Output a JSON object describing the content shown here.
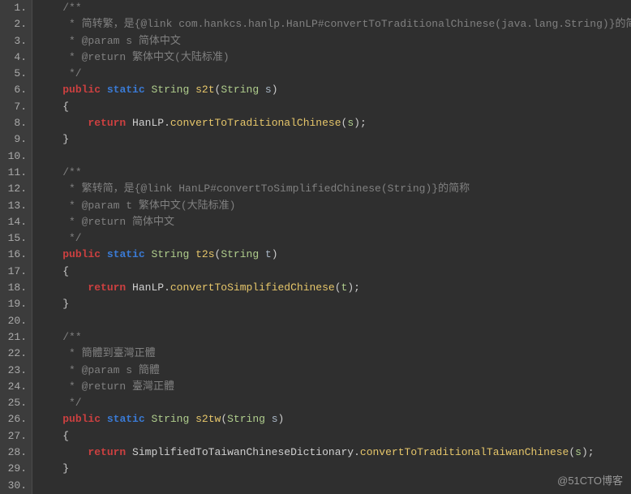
{
  "watermark": "@51CTO博客",
  "lines": [
    {
      "num": "1.",
      "tokens": [
        [
          "    ",
          ""
        ],
        [
          "/**",
          "c-comment"
        ]
      ]
    },
    {
      "num": "2.",
      "tokens": [
        [
          "     * 简转繁，是{@link com.hankcs.hanlp.HanLP#convertToTraditionalChinese(java.lang.String)}的简称",
          "c-comment"
        ]
      ]
    },
    {
      "num": "3.",
      "tokens": [
        [
          "     * @param s 简体中文",
          "c-comment"
        ]
      ]
    },
    {
      "num": "4.",
      "tokens": [
        [
          "     * @return 繁体中文(大陆标准)",
          "c-comment"
        ]
      ]
    },
    {
      "num": "5.",
      "tokens": [
        [
          "     */",
          "c-comment"
        ]
      ]
    },
    {
      "num": "6.",
      "tokens": [
        [
          "    ",
          ""
        ],
        [
          "public",
          "c-keyword"
        ],
        [
          " ",
          ""
        ],
        [
          "static",
          "c-keyword2"
        ],
        [
          " ",
          ""
        ],
        [
          "String",
          "c-type"
        ],
        [
          " ",
          ""
        ],
        [
          "s2t",
          "c-fname"
        ],
        [
          "(",
          "c-punct"
        ],
        [
          "String",
          "c-type"
        ],
        [
          " s",
          ""
        ],
        [
          ")",
          "c-punct"
        ]
      ]
    },
    {
      "num": "7.",
      "tokens": [
        [
          "    ",
          ""
        ],
        [
          "{",
          "c-punct"
        ]
      ]
    },
    {
      "num": "8.",
      "tokens": [
        [
          "        ",
          ""
        ],
        [
          "return",
          "c-keyword"
        ],
        [
          " ",
          ""
        ],
        [
          "HanLP",
          "c-ident"
        ],
        [
          ".",
          "c-punct"
        ],
        [
          "convertToTraditionalChinese",
          "c-method"
        ],
        [
          "(",
          "c-punct"
        ],
        [
          "s",
          "c-var"
        ],
        [
          ");",
          "c-punct"
        ]
      ]
    },
    {
      "num": "9.",
      "tokens": [
        [
          "    ",
          ""
        ],
        [
          "}",
          "c-punct"
        ]
      ]
    },
    {
      "num": "10.",
      "tokens": [
        [
          " ",
          ""
        ]
      ]
    },
    {
      "num": "11.",
      "tokens": [
        [
          "    ",
          ""
        ],
        [
          "/**",
          "c-comment"
        ]
      ]
    },
    {
      "num": "12.",
      "tokens": [
        [
          "     * 繁转简，是{@link HanLP#convertToSimplifiedChinese(String)}的简称",
          "c-comment"
        ]
      ]
    },
    {
      "num": "13.",
      "tokens": [
        [
          "     * @param t 繁体中文(大陆标准)",
          "c-comment"
        ]
      ]
    },
    {
      "num": "14.",
      "tokens": [
        [
          "     * @return 简体中文",
          "c-comment"
        ]
      ]
    },
    {
      "num": "15.",
      "tokens": [
        [
          "     */",
          "c-comment"
        ]
      ]
    },
    {
      "num": "16.",
      "tokens": [
        [
          "    ",
          ""
        ],
        [
          "public",
          "c-keyword"
        ],
        [
          " ",
          ""
        ],
        [
          "static",
          "c-keyword2"
        ],
        [
          " ",
          ""
        ],
        [
          "String",
          "c-type"
        ],
        [
          " ",
          ""
        ],
        [
          "t2s",
          "c-fname"
        ],
        [
          "(",
          "c-punct"
        ],
        [
          "String",
          "c-type"
        ],
        [
          " t",
          ""
        ],
        [
          ")",
          "c-punct"
        ]
      ]
    },
    {
      "num": "17.",
      "tokens": [
        [
          "    ",
          ""
        ],
        [
          "{",
          "c-punct"
        ]
      ]
    },
    {
      "num": "18.",
      "tokens": [
        [
          "        ",
          ""
        ],
        [
          "return",
          "c-keyword"
        ],
        [
          " ",
          ""
        ],
        [
          "HanLP",
          "c-ident"
        ],
        [
          ".",
          "c-punct"
        ],
        [
          "convertToSimplifiedChinese",
          "c-method"
        ],
        [
          "(",
          "c-punct"
        ],
        [
          "t",
          "c-var"
        ],
        [
          ");",
          "c-punct"
        ]
      ]
    },
    {
      "num": "19.",
      "tokens": [
        [
          "    ",
          ""
        ],
        [
          "}",
          "c-punct"
        ]
      ]
    },
    {
      "num": "20.",
      "tokens": [
        [
          " ",
          ""
        ]
      ]
    },
    {
      "num": "21.",
      "tokens": [
        [
          "    ",
          ""
        ],
        [
          "/**",
          "c-comment"
        ]
      ]
    },
    {
      "num": "22.",
      "tokens": [
        [
          "     * 簡體到臺灣正體",
          "c-comment"
        ]
      ]
    },
    {
      "num": "23.",
      "tokens": [
        [
          "     * @param s 簡體",
          "c-comment"
        ]
      ]
    },
    {
      "num": "24.",
      "tokens": [
        [
          "     * @return 臺灣正體",
          "c-comment"
        ]
      ]
    },
    {
      "num": "25.",
      "tokens": [
        [
          "     */",
          "c-comment"
        ]
      ]
    },
    {
      "num": "26.",
      "tokens": [
        [
          "    ",
          ""
        ],
        [
          "public",
          "c-keyword"
        ],
        [
          " ",
          ""
        ],
        [
          "static",
          "c-keyword2"
        ],
        [
          " ",
          ""
        ],
        [
          "String",
          "c-type"
        ],
        [
          " ",
          ""
        ],
        [
          "s2tw",
          "c-fname"
        ],
        [
          "(",
          "c-punct"
        ],
        [
          "String",
          "c-type"
        ],
        [
          " s",
          ""
        ],
        [
          ")",
          "c-punct"
        ]
      ]
    },
    {
      "num": "27.",
      "tokens": [
        [
          "    ",
          ""
        ],
        [
          "{",
          "c-punct"
        ]
      ]
    },
    {
      "num": "28.",
      "tokens": [
        [
          "        ",
          ""
        ],
        [
          "return",
          "c-keyword"
        ],
        [
          " ",
          ""
        ],
        [
          "SimplifiedToTaiwanChineseDictionary",
          "c-ident"
        ],
        [
          ".",
          "c-punct"
        ],
        [
          "convertToTraditionalTaiwanChinese",
          "c-method"
        ],
        [
          "(",
          "c-punct"
        ],
        [
          "s",
          "c-var"
        ],
        [
          ");",
          "c-punct"
        ]
      ]
    },
    {
      "num": "29.",
      "tokens": [
        [
          "    ",
          ""
        ],
        [
          "}",
          "c-punct"
        ]
      ]
    },
    {
      "num": "30.",
      "tokens": [
        [
          " ",
          ""
        ]
      ]
    }
  ]
}
